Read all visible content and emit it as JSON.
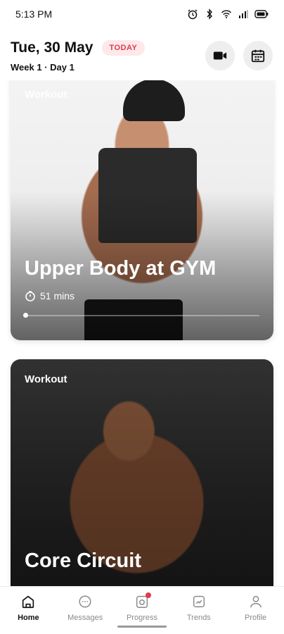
{
  "status_bar": {
    "time": "5:13 PM",
    "icons": [
      "alarm-icon",
      "bluetooth-icon",
      "wifi-icon",
      "signal-icon",
      "battery-icon"
    ]
  },
  "header": {
    "date": "Tue, 30 May",
    "today_label": "TODAY",
    "week": "Week 1",
    "separator": "·",
    "day": "Day 1",
    "buttons": [
      "video-icon",
      "calendar-icon"
    ]
  },
  "feed": {
    "cards": [
      {
        "tag": "Workout",
        "title": "Upper Body at GYM",
        "duration": "51 mins"
      },
      {
        "tag": "Workout",
        "title": "Core Circuit"
      }
    ]
  },
  "nav": {
    "items": [
      {
        "label": "Home",
        "icon": "home-icon",
        "active": true
      },
      {
        "label": "Messages",
        "icon": "chat-icon",
        "active": false
      },
      {
        "label": "Progress",
        "icon": "progress-icon",
        "active": false
      },
      {
        "label": "Trends",
        "icon": "trends-icon",
        "active": false
      },
      {
        "label": "Profile",
        "icon": "profile-icon",
        "active": false
      }
    ]
  },
  "colors": {
    "accent": "#e2394d",
    "today_bg": "#fde8ea",
    "button_bg": "#eeeeee"
  }
}
